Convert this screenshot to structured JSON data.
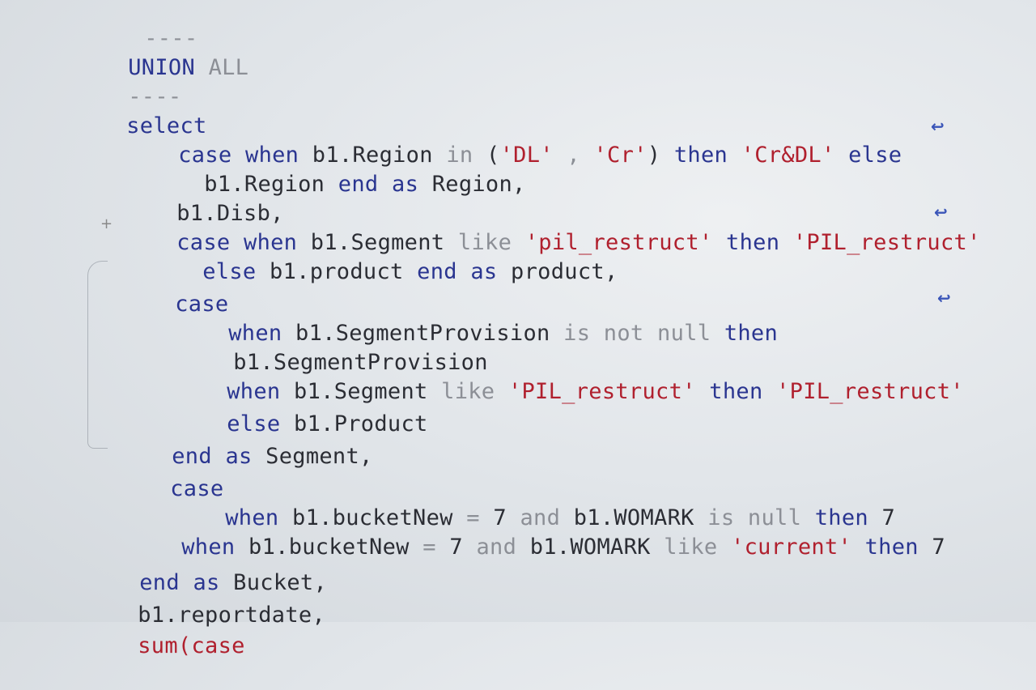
{
  "lines": {
    "l0": {
      "t0": "----"
    },
    "l1": {
      "t0": "UNION",
      "t1": " ALL"
    },
    "l2": {
      "t0": "----"
    },
    "l3": {
      "t0": "select"
    },
    "l4": {
      "t0": "case when",
      "t1": " b1.Region ",
      "t2": "in",
      "t3": " (",
      "t4": "'DL'",
      "t5": " , ",
      "t6": "'Cr'",
      "t7": ") ",
      "t8": "then",
      "t9": " ",
      "t10": "'Cr&DL'",
      "t11": " ",
      "t12": "else"
    },
    "l5": {
      "t0": "b1.Region ",
      "t1": "end",
      "t2": " ",
      "t3": "as",
      "t4": " Region,"
    },
    "l6": {
      "t0": "b1.Disb,"
    },
    "l7": {
      "t0": "case when",
      "t1": " b1.Segment ",
      "t2": "like",
      "t3": " ",
      "t4": "'pil_restruct'",
      "t5": " ",
      "t6": "then",
      "t7": " ",
      "t8": "'PIL_restruct'"
    },
    "l8": {
      "t0": "else",
      "t1": " b1.product ",
      "t2": "end",
      "t3": " ",
      "t4": "as",
      "t5": " product,"
    },
    "l9": {
      "t0": "case"
    },
    "l10": {
      "t0": "when",
      "t1": " b1.SegmentProvision ",
      "t2": "is not null",
      "t3": " ",
      "t4": "then"
    },
    "l11": {
      "t0": "b1.SegmentProvision"
    },
    "l12": {
      "t0": "when",
      "t1": " b1.Segment ",
      "t2": "like",
      "t3": " ",
      "t4": "'PIL_restruct'",
      "t5": " ",
      "t6": "then",
      "t7": " ",
      "t8": "'PIL_restruct'"
    },
    "l13": {
      "t0": "else",
      "t1": " b1.Product"
    },
    "l14": {
      "t0": "end",
      "t1": " ",
      "t2": "as",
      "t3": " Segment,"
    },
    "l15": {
      "t0": "case"
    },
    "l16": {
      "t0": "when",
      "t1": " b1.bucketNew ",
      "t2": "=",
      "t3": " 7 ",
      "t4": "and",
      "t5": " b1.WOMARK ",
      "t6": "is null",
      "t7": " ",
      "t8": "then",
      "t9": " 7"
    },
    "l17": {
      "t0": "when",
      "t1": " b1.bucketNew ",
      "t2": "=",
      "t3": " 7 ",
      "t4": "and",
      "t5": " b1.WOMARK ",
      "t6": "like",
      "t7": " ",
      "t8": "'current'",
      "t9": " ",
      "t10": "then",
      "t11": " 7"
    },
    "l18": {
      "t0": "end",
      "t1": " ",
      "t2": "as",
      "t3": " Bucket,"
    },
    "l19": {
      "t0": "b1.reportdate,"
    },
    "l20": {
      "t0": "sum(case"
    }
  },
  "colors": {
    "keyword": "#2a3590",
    "operator": "#8c8f96",
    "string": "#b0202e",
    "identifier": "#2b2d34"
  },
  "icons": [
    "word-wrap-icon",
    "word-wrap-icon",
    "word-wrap-icon"
  ]
}
